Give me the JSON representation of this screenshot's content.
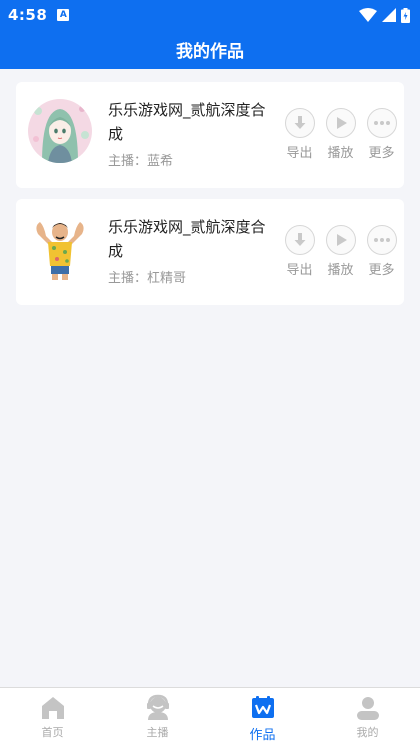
{
  "status": {
    "time": "4:58",
    "badge": "A"
  },
  "header": {
    "title": "我的作品"
  },
  "tracks": [
    {
      "title": "乐乐游戏网_贰航深度合成",
      "host": "主播：蓝希",
      "actions": {
        "export": "导出",
        "play": "播放",
        "more": "更多"
      }
    },
    {
      "title": "乐乐游戏网_贰航深度合成",
      "host": "主播：杠精哥",
      "actions": {
        "export": "导出",
        "play": "播放",
        "more": "更多"
      }
    }
  ],
  "tabs": [
    {
      "label": "首页",
      "icon": "home-icon",
      "active": false
    },
    {
      "label": "主播",
      "icon": "host-icon",
      "active": false
    },
    {
      "label": "作品",
      "icon": "works-icon",
      "active": true
    },
    {
      "label": "我的",
      "icon": "profile-icon",
      "active": false
    }
  ],
  "colors": {
    "primary": "#0e6ff0",
    "background": "#f4f5f9",
    "muted": "#999999"
  }
}
